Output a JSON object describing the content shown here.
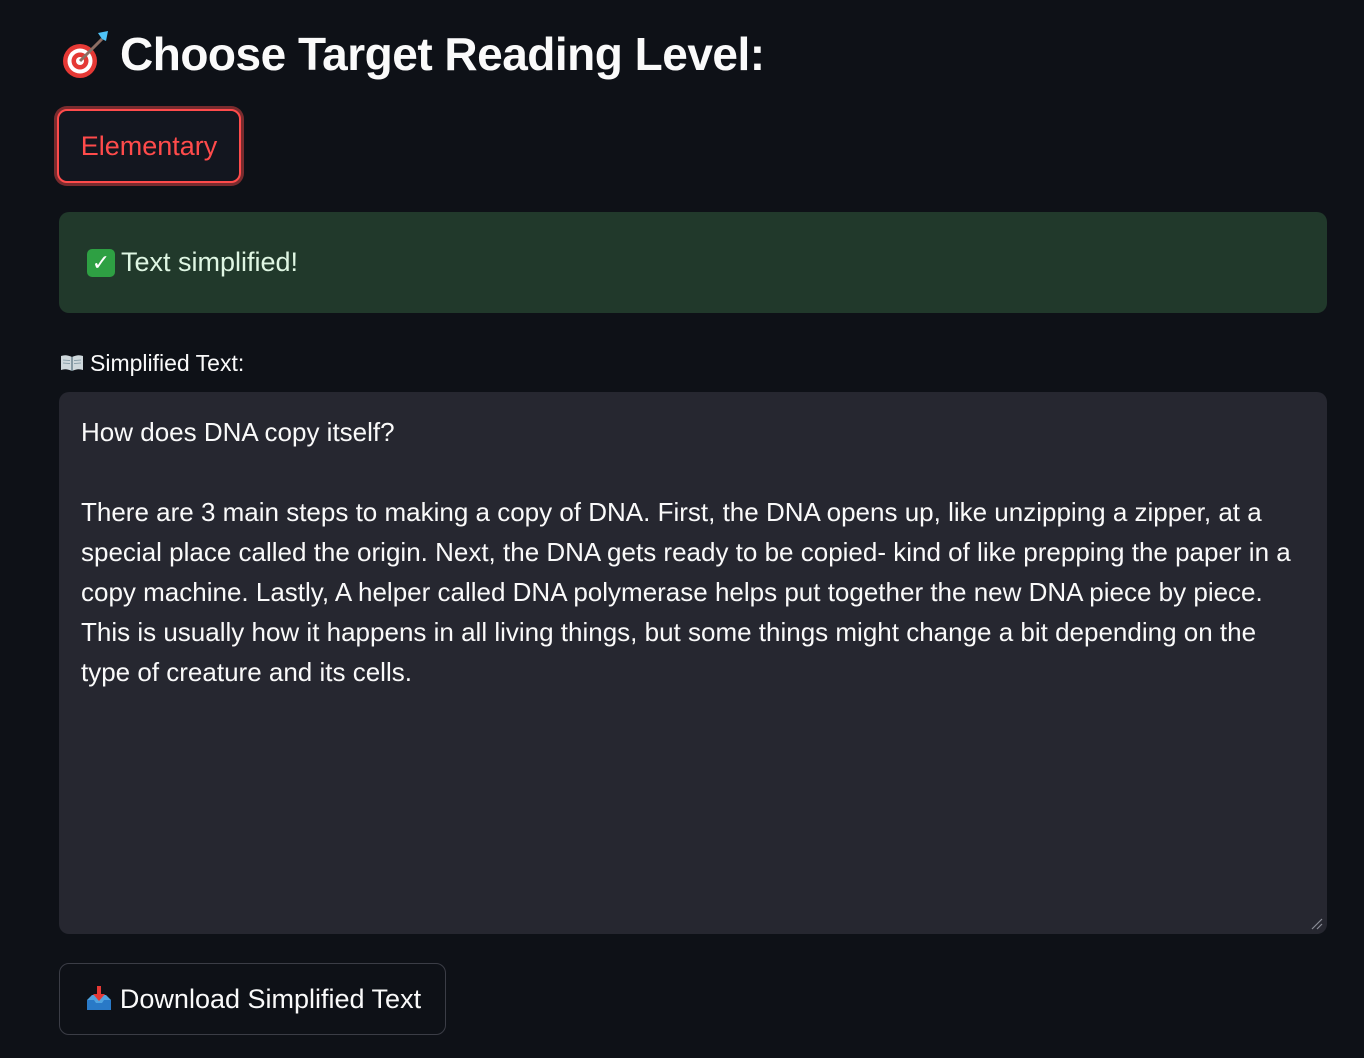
{
  "header": {
    "title": "Choose Target Reading Level:",
    "title_icon": "target-dart-icon"
  },
  "level_selector": {
    "selected_label": "Elementary",
    "accent_color": "#ff4b4b"
  },
  "status": {
    "message": "Text simplified!",
    "icon": "check-mark-icon",
    "color": "#21392b"
  },
  "output": {
    "label": "Simplified Text:",
    "label_icon": "open-book-icon",
    "value": "How does DNA copy itself?\n\nThere are 3 main steps to making a copy of DNA. First, the DNA opens up, like unzipping a zipper, at a special place called the origin. Next, the DNA gets ready to be copied- kind of like prepping the paper in a copy machine. Lastly, A helper called DNA polymerase helps put together the new DNA piece by piece. This is usually how it happens in all living things, but some things might change a bit depending on the type of creature and its cells."
  },
  "download": {
    "label": "Download Simplified Text",
    "icon": "inbox-tray-icon"
  },
  "theme": {
    "background": "#0e1117",
    "surface": "#262730",
    "text": "#fafafa"
  }
}
